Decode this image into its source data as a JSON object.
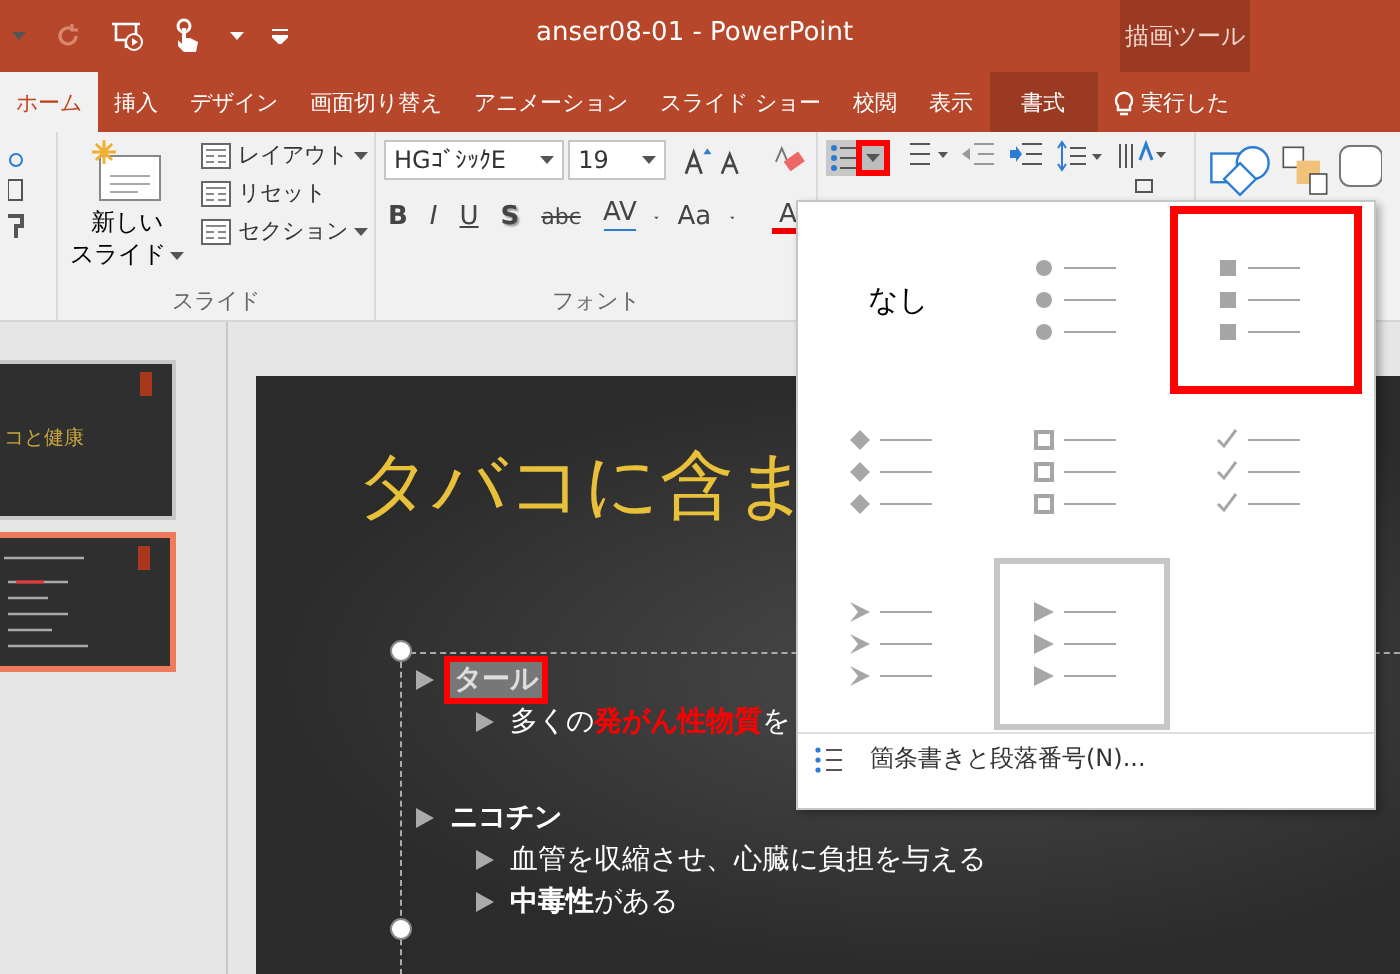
{
  "title_bar": {
    "title": "anser08-01 - PowerPoint",
    "context_label": "描画ツール"
  },
  "tabs": [
    {
      "label": "ホーム",
      "selected": true,
      "kind": "normal"
    },
    {
      "label": "挿入",
      "selected": false,
      "kind": "normal"
    },
    {
      "label": "デザイン",
      "selected": false,
      "kind": "normal"
    },
    {
      "label": "画面切り替え",
      "selected": false,
      "kind": "normal"
    },
    {
      "label": "アニメーション",
      "selected": false,
      "kind": "normal"
    },
    {
      "label": "スライド ショー",
      "selected": false,
      "kind": "normal"
    },
    {
      "label": "校閲",
      "selected": false,
      "kind": "normal"
    },
    {
      "label": "表示",
      "selected": false,
      "kind": "normal"
    },
    {
      "label": "書式",
      "selected": false,
      "kind": "contextual"
    }
  ],
  "tell_me": "実行した",
  "ribbon": {
    "slides_group": {
      "new_slide": [
        "新しい",
        "スライド"
      ],
      "items": [
        "レイアウト",
        "リセット",
        "セクション"
      ],
      "label": "スライド"
    },
    "font_group": {
      "font_name": "HGｺﾞｼｯｸE",
      "font_size": "19",
      "styles": [
        "B",
        "I",
        "U",
        "S",
        "abc"
      ],
      "spacing": "AV",
      "case": "Aa",
      "color_button": "A",
      "label": "フォント"
    },
    "paragraph_group": {
      "bullets_marked": true
    }
  },
  "bullet_menu": {
    "items": [
      {
        "kind": "none",
        "label": "なし",
        "selected": false,
        "marked": false
      },
      {
        "kind": "circle",
        "selected": false,
        "marked": false
      },
      {
        "kind": "square",
        "selected": false,
        "marked": true
      },
      {
        "kind": "diamond",
        "selected": false,
        "marked": false
      },
      {
        "kind": "hollow",
        "selected": false,
        "marked": false
      },
      {
        "kind": "check",
        "selected": false,
        "marked": false
      },
      {
        "kind": "arrowhead",
        "selected": false,
        "marked": false
      },
      {
        "kind": "triangle",
        "selected": true,
        "marked": false
      }
    ],
    "footer": "箇条書きと段落番号(N)..."
  },
  "thumbnails": [
    {
      "title": "コと健康",
      "selected": false
    },
    {
      "selected": true
    }
  ],
  "slide": {
    "title": "タバコに含ま",
    "bullets": [
      {
        "text": "タール",
        "selected": true,
        "marked": true,
        "children": [
          {
            "text": "多くの**発がん性物質**を",
            "color": "#ff0000"
          }
        ]
      },
      {
        "text": "ニコチン",
        "selected": false,
        "marked": false,
        "children": [
          {
            "text": "血管を収縮させ、心臓に負担を与える"
          },
          {
            "text": "**中毒性**がある"
          }
        ]
      }
    ]
  }
}
